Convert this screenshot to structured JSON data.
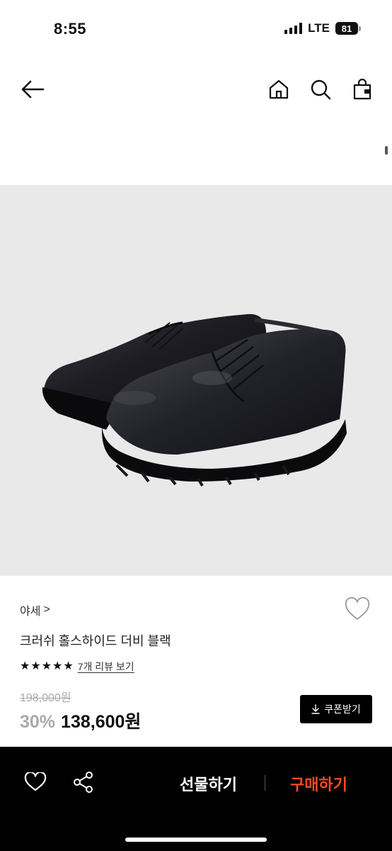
{
  "status_bar": {
    "time": "8:55",
    "network": "LTE",
    "battery": "81"
  },
  "nav": {
    "back_icon": "arrow-left-icon",
    "home_icon": "home-icon",
    "search_icon": "search-icon",
    "bag_icon": "shopping-bag-icon"
  },
  "product": {
    "image_alt": "black leather derby shoes",
    "brand": "야세",
    "brand_chevron": ">",
    "title": "크러쉬 홀스하이드 더비 블랙",
    "rating_stars": 5,
    "review_link": "7개 리뷰 보기",
    "original_price": "198,000원",
    "discount": "30%",
    "sale_price": "138,600원",
    "coupon_label": "쿠폰받기"
  },
  "bottom_bar": {
    "gift_label": "선물하기",
    "buy_label": "구매하기"
  },
  "colors": {
    "accent": "#ff4b1f",
    "bottom_bar": "#000000",
    "image_bg": "#e9e9e9"
  }
}
